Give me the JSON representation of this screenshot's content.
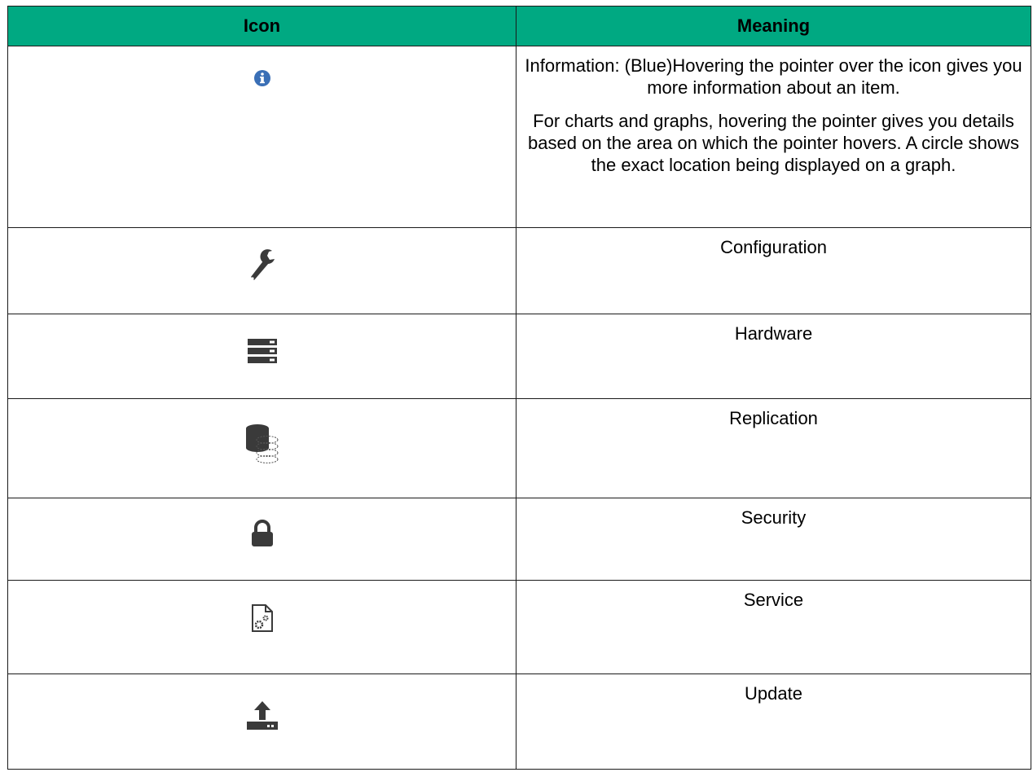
{
  "table": {
    "headers": {
      "icon": "Icon",
      "meaning": "Meaning"
    },
    "rows": [
      {
        "icon": "info-icon",
        "color": "#3a6fb6",
        "paragraphs": [
          "Information: (Blue)Hovering the pointer over the icon gives you more information about an item.",
          "For charts and graphs, hovering the pointer gives you details based on the area on which the pointer hovers. A circle shows the exact location being displayed on a graph."
        ]
      },
      {
        "icon": "wrench-icon",
        "text": "Configuration"
      },
      {
        "icon": "server-icon",
        "text": "Hardware"
      },
      {
        "icon": "database-icon",
        "text": "Replication"
      },
      {
        "icon": "lock-icon",
        "text": "Security"
      },
      {
        "icon": "document-gear-icon",
        "text": "Service"
      },
      {
        "icon": "upload-icon",
        "text": "Update"
      }
    ]
  },
  "colors": {
    "header_bg": "#00a982",
    "icon_dark": "#3a3a3a",
    "info_blue": "#3a6fb6"
  }
}
